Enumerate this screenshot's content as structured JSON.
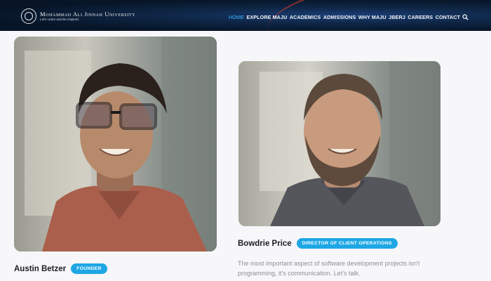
{
  "header": {
    "logo_name": "Mohammad Ali Jinnah University",
    "logo_tagline": "Let's Learn and Be Inspired",
    "nav": [
      {
        "label": "HOME",
        "active": true
      },
      {
        "label": "EXPLORE MAJU",
        "active": false
      },
      {
        "label": "ACADEMICS",
        "active": false
      },
      {
        "label": "ADMISSIONS",
        "active": false
      },
      {
        "label": "WHY MAJU",
        "active": false
      },
      {
        "label": "JBERJ",
        "active": false
      },
      {
        "label": "CAREERS",
        "active": false
      },
      {
        "label": "CONTACT",
        "active": false
      }
    ],
    "accent_color": "#3cb4ff"
  },
  "team": [
    {
      "name": "Austin Betzer",
      "role": "FOUNDER",
      "photo_icon": "portrait-photo"
    },
    {
      "name": "Bowdrie Price",
      "role": "DIRECTOR OF CLIENT OPERATIONS",
      "photo_icon": "portrait-photo",
      "bio": "The most important aspect of software development projects isn't programming, it's communication. Let's talk."
    }
  ],
  "colors": {
    "badge": "#1ea7e4",
    "name_text": "#1d1e25",
    "bio_text": "#8d8f97"
  }
}
